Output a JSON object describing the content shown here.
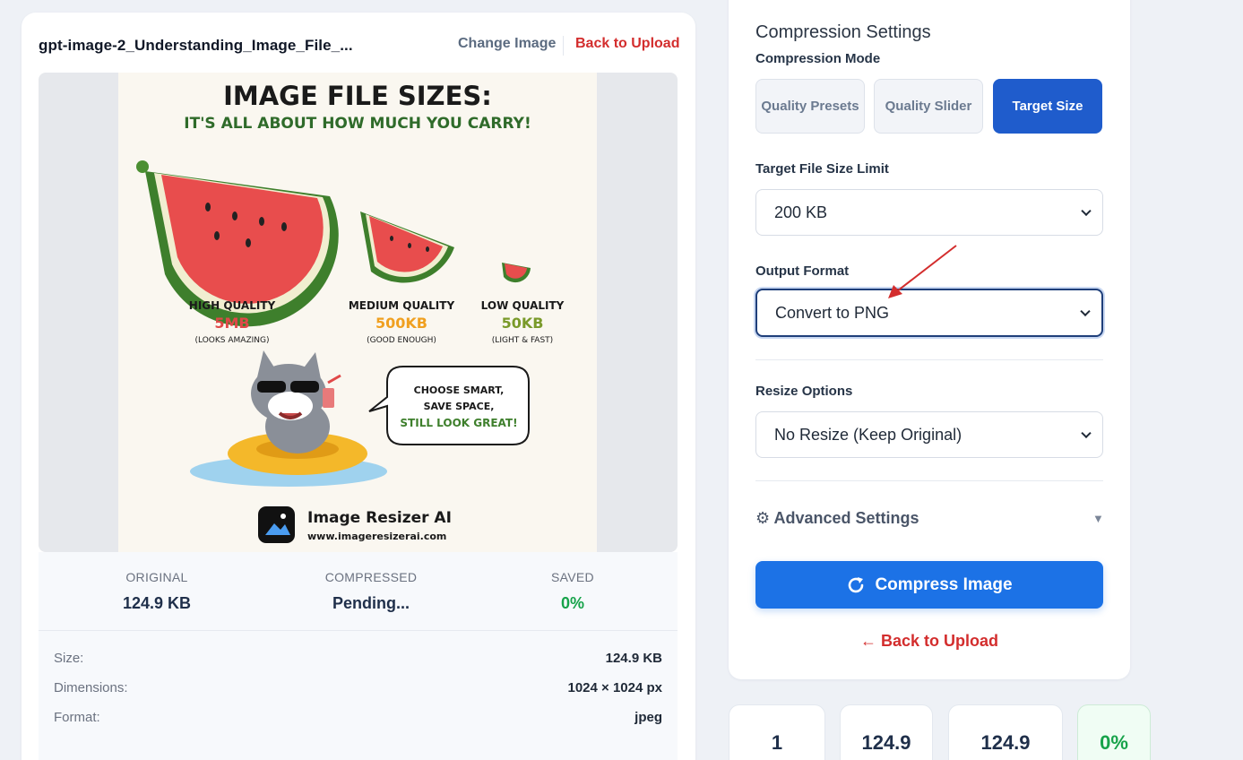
{
  "file": {
    "name": "gpt-image-2_Understanding_Image_File_...",
    "change_label": "Change Image",
    "back_label": "Back to Upload"
  },
  "preview": {
    "title": "IMAGE FILE SIZES:",
    "subtitle": "IT'S ALL ABOUT HOW MUCH YOU CARRY!",
    "tiers": [
      {
        "quality": "HIGH QUALITY",
        "size": "5MB",
        "note": "(LOOKS AMAZING)",
        "color": "#e04848"
      },
      {
        "quality": "MEDIUM QUALITY",
        "size": "500KB",
        "note": "(GOOD ENOUGH)",
        "color": "#f0a020"
      },
      {
        "quality": "LOW QUALITY",
        "size": "50KB",
        "note": "(LIGHT & FAST)",
        "color": "#7a9a2a"
      }
    ],
    "bubble": [
      "CHOOSE SMART,",
      "SAVE SPACE,",
      "STILL LOOK GREAT!"
    ],
    "brand_name": "Image Resizer AI",
    "brand_url": "www.imageresizerai.com"
  },
  "stats": {
    "original_label": "ORIGINAL",
    "original_value": "124.9 KB",
    "compressed_label": "COMPRESSED",
    "compressed_value": "Pending...",
    "saved_label": "SAVED",
    "saved_value": "0%"
  },
  "meta": [
    {
      "key": "Size:",
      "value": "124.9 KB"
    },
    {
      "key": "Dimensions:",
      "value": "1024 × 1024 px"
    },
    {
      "key": "Format:",
      "value": "jpeg"
    }
  ],
  "settings": {
    "title": "Compression Settings",
    "mode_label": "Compression Mode",
    "modes": [
      "Quality Presets",
      "Quality Slider",
      "Target Size"
    ],
    "active_mode": "Target Size",
    "target_label": "Target File Size Limit",
    "target_value": "200 KB",
    "format_label": "Output Format",
    "format_value": "Convert to PNG",
    "resize_label": "Resize Options",
    "resize_value": "No Resize (Keep Original)",
    "advanced_label": "⚙ Advanced Settings",
    "advanced_caret": "▼",
    "compress_label": "Compress Image",
    "back_label": "← Back to Upload"
  },
  "summary": [
    "1",
    "124.9",
    "124.9",
    "0%"
  ],
  "colors": {
    "accent": "#1c72e6",
    "active_mode": "#1f5ccc",
    "danger": "#d32d2d",
    "success": "#17a34a"
  }
}
